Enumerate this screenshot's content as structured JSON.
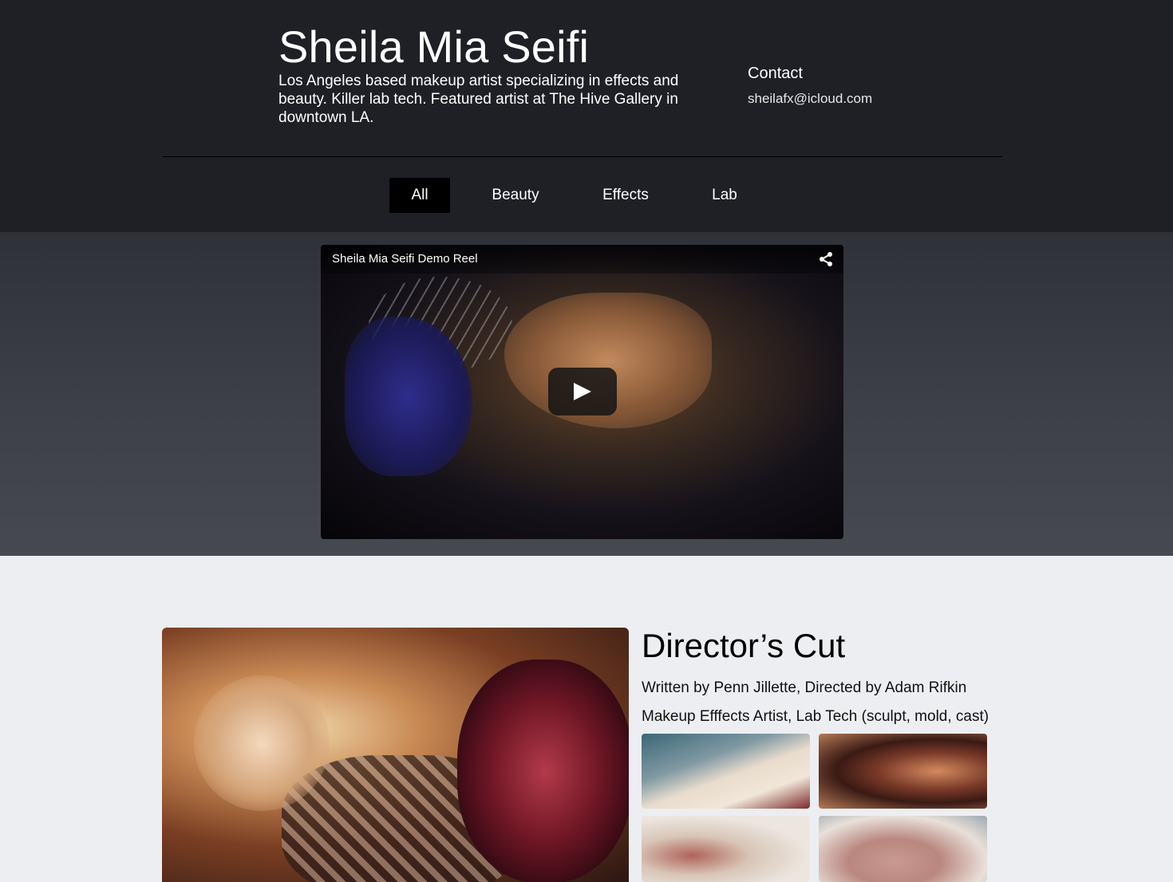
{
  "header": {
    "title": "Sheila Mia Seifi",
    "tagline": "Los Angeles based makeup artist specializing in effects and beauty. Killer lab tech. Featured artist at The Hive Gallery in downtown LA.",
    "contact_title": "Contact",
    "contact_email": "sheilafx@icloud.com"
  },
  "nav": {
    "tabs": [
      {
        "label": "All",
        "active": true
      },
      {
        "label": "Beauty",
        "active": false
      },
      {
        "label": "Effects",
        "active": false
      },
      {
        "label": "Lab",
        "active": false
      }
    ]
  },
  "video": {
    "title": "Sheila Mia Seifi Demo Reel",
    "share_icon": "share-icon",
    "play_icon": "play-icon"
  },
  "project": {
    "title": "Director’s Cut",
    "credits": "Written by Penn Jillette,  Directed by Adam Rifkin",
    "role": "Makeup Efffects Artist, Lab Tech (sculpt, mold, cast)"
  },
  "colors": {
    "header_bg": "#1e2026",
    "active_tab_bg": "#000000",
    "page_bg": "#eceef1"
  }
}
